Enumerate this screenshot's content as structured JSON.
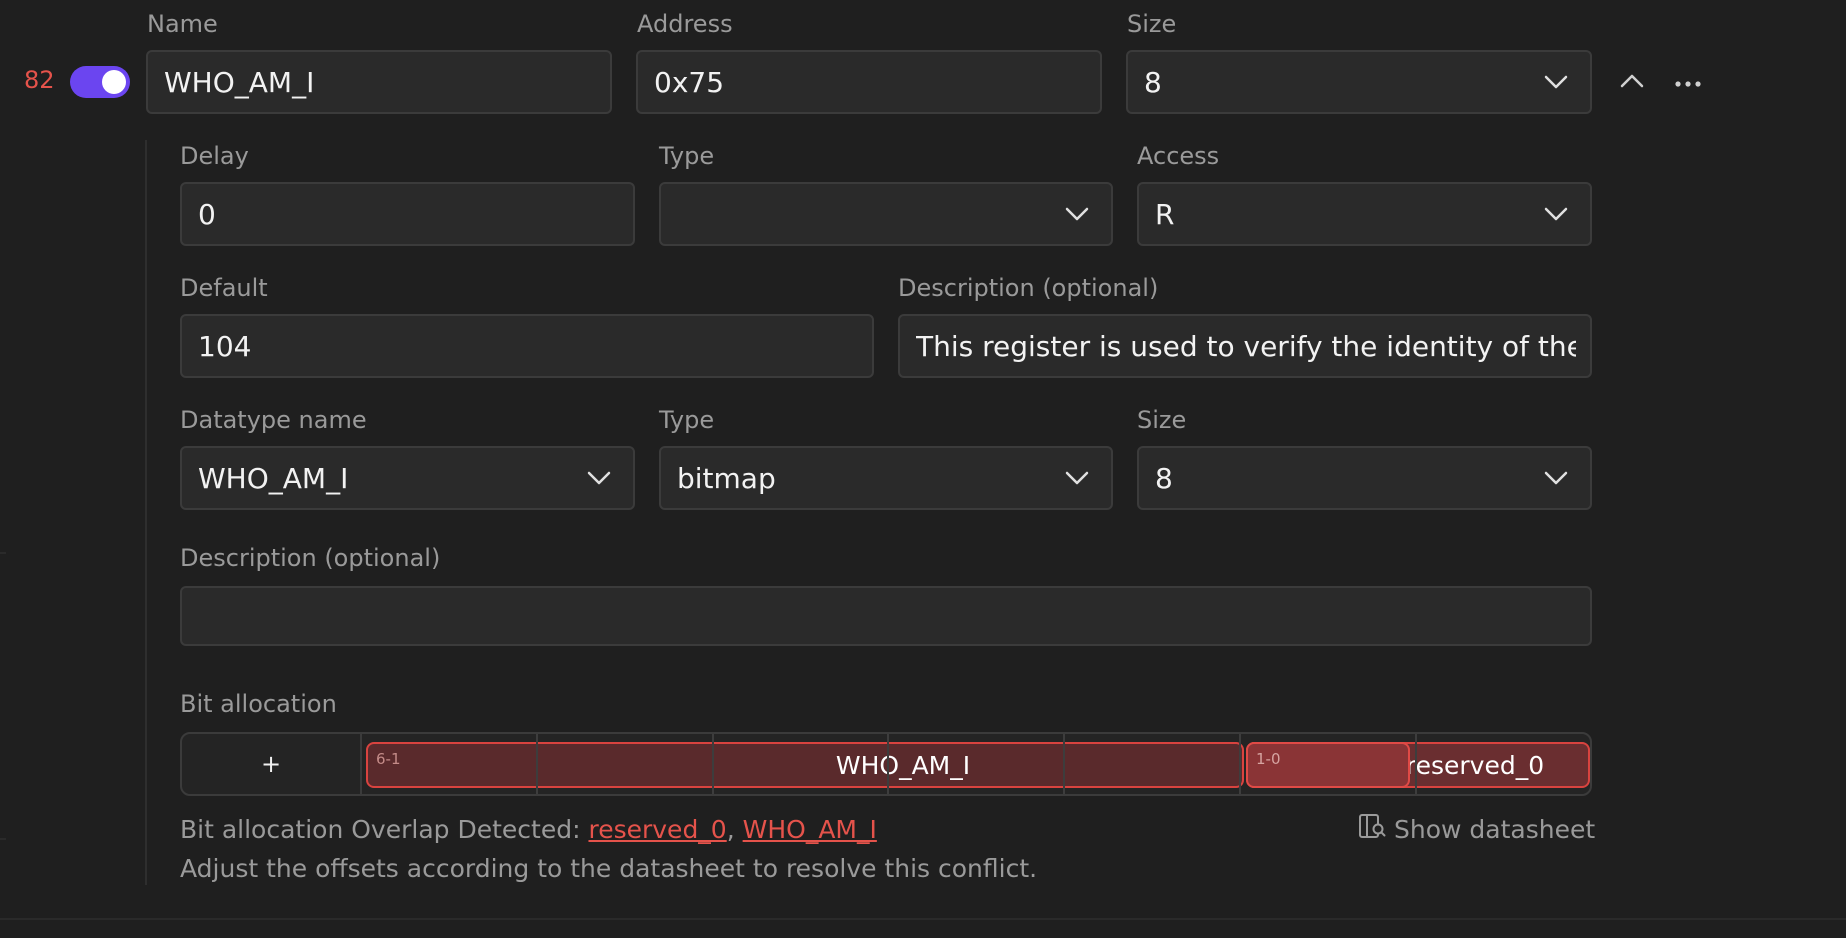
{
  "register": {
    "index": "82",
    "enabled": true,
    "name_label": "Name",
    "name_value": "WHO_AM_I",
    "address_label": "Address",
    "address_value": "0x75",
    "size_label": "Size",
    "size_value": "8"
  },
  "details": {
    "delay_label": "Delay",
    "delay_value": "0",
    "type_label": "Type",
    "type_value": "",
    "access_label": "Access",
    "access_value": "R",
    "default_label": "Default",
    "default_value": "104",
    "description_label": "Description (optional)",
    "description_value": "This register is used to verify the identity of the device"
  },
  "datatype": {
    "name_label": "Datatype name",
    "name_value": "WHO_AM_I",
    "type_label": "Type",
    "type_value": "bitmap",
    "size_label": "Size",
    "size_value": "8",
    "description_label": "Description (optional)",
    "description_value": ""
  },
  "bit_allocation": {
    "label": "Bit allocation",
    "add_label": "+",
    "fields": [
      {
        "name": "WHO_AM_I",
        "range": "6-1"
      },
      {
        "name": "reserved_0",
        "range": "1-0"
      }
    ],
    "warning_prefix": "Bit allocation Overlap Detected:",
    "conflict_links": [
      "reserved_0",
      "WHO_AM_I"
    ],
    "separator": ",",
    "hint": "Adjust the offsets according to the datasheet to resolve this conflict.",
    "datasheet_label": "Show datasheet"
  },
  "colors": {
    "toggle_on": "#6b45f0",
    "index_red": "#e5534b",
    "field_border": "#d9433f"
  },
  "icons": {
    "chevron": "chevron-down-icon",
    "collapse": "chevron-up-icon",
    "more": "more-horizontal-icon",
    "datasheet": "datasheet-icon"
  }
}
